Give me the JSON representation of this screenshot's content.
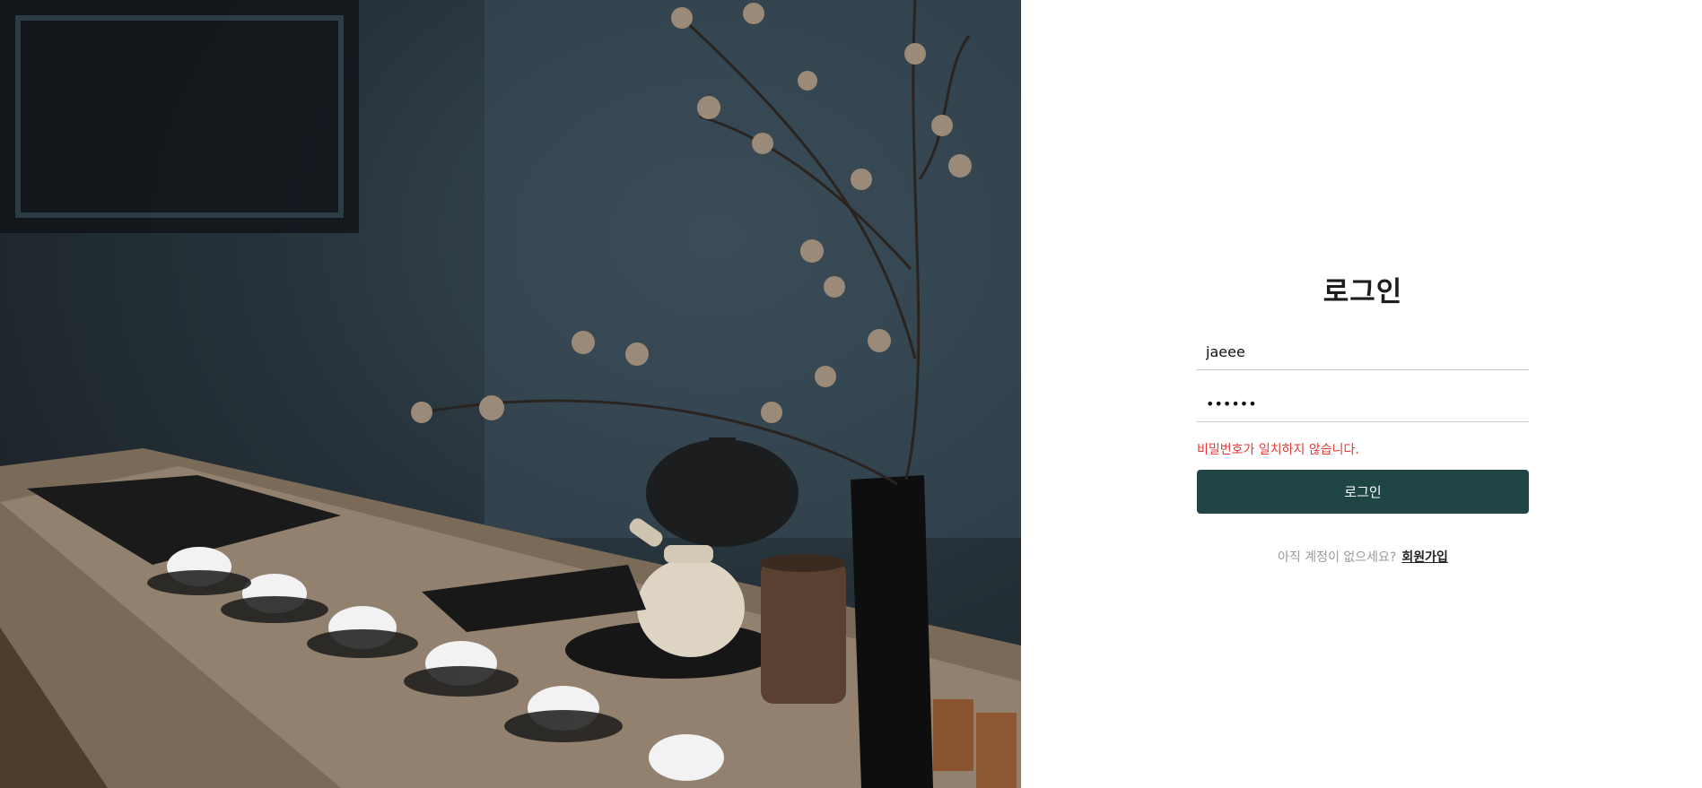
{
  "hero": {
    "image": "photo of a wooden tea table with teapot, white cups, dark vase and dried flower branches"
  },
  "login": {
    "title": "로그인",
    "username_value": "jaeee",
    "password_value": "••••••",
    "error_text": "비밀번호가 일치하지 않습니다.",
    "submit_label": "로그인",
    "signup_prompt": "아직 계정이 없으세요?",
    "signup_link": "회원가입"
  },
  "colors": {
    "button_bg": "#1f4644",
    "error": "#e53935"
  }
}
